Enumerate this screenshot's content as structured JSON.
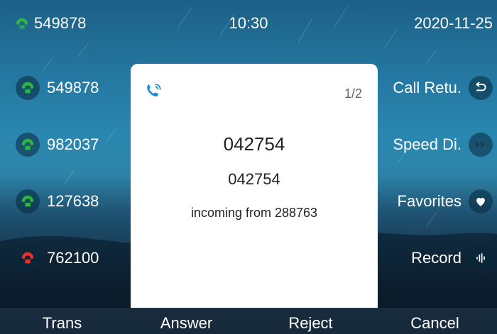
{
  "status": {
    "line_number": "549878",
    "time": "10:30",
    "date": "2020-11-25"
  },
  "lines": [
    {
      "number": "549878",
      "state": "registered"
    },
    {
      "number": "982037",
      "state": "registered"
    },
    {
      "number": "127638",
      "state": "registered"
    },
    {
      "number": "762100",
      "state": "alert"
    }
  ],
  "colors": {
    "registered": "#2fb344",
    "alert": "#e8302a",
    "dialog_icon": "#1a8fd8"
  },
  "soft_keys": [
    {
      "label": "Call Retu.",
      "icon": "return-icon"
    },
    {
      "label": "Speed Di.",
      "icon": "fast-forward-icon"
    },
    {
      "label": "Favorites",
      "icon": "heart-icon"
    },
    {
      "label": "Record",
      "icon": "soundwave-icon"
    }
  ],
  "dialog": {
    "icon": "incoming-call-icon",
    "page": "1/2",
    "caller_primary": "042754",
    "caller_secondary": "042754",
    "message": "incoming from 288763"
  },
  "bottom_bar": {
    "trans": "Trans",
    "answer": "Answer",
    "reject": "Reject",
    "cancel": "Cancel"
  }
}
